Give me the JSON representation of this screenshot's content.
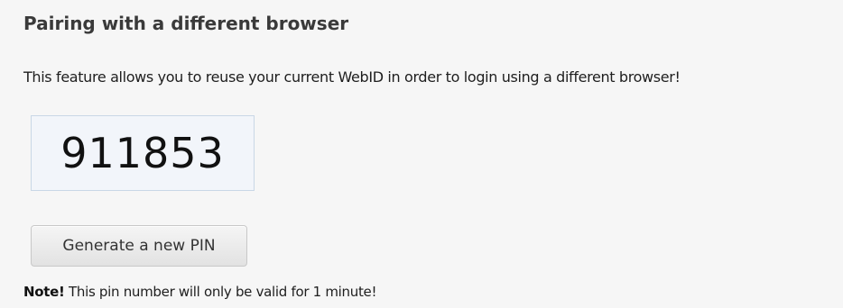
{
  "section": {
    "title": "Pairing with a different browser",
    "description": "This feature allows you to reuse your current WebID in order to login using a different browser!"
  },
  "pin": {
    "value": "911853"
  },
  "actions": {
    "generate_label": "Generate a new PIN"
  },
  "note": {
    "label": "Note!",
    "text": "This pin number will only be valid for 1 minute!"
  }
}
